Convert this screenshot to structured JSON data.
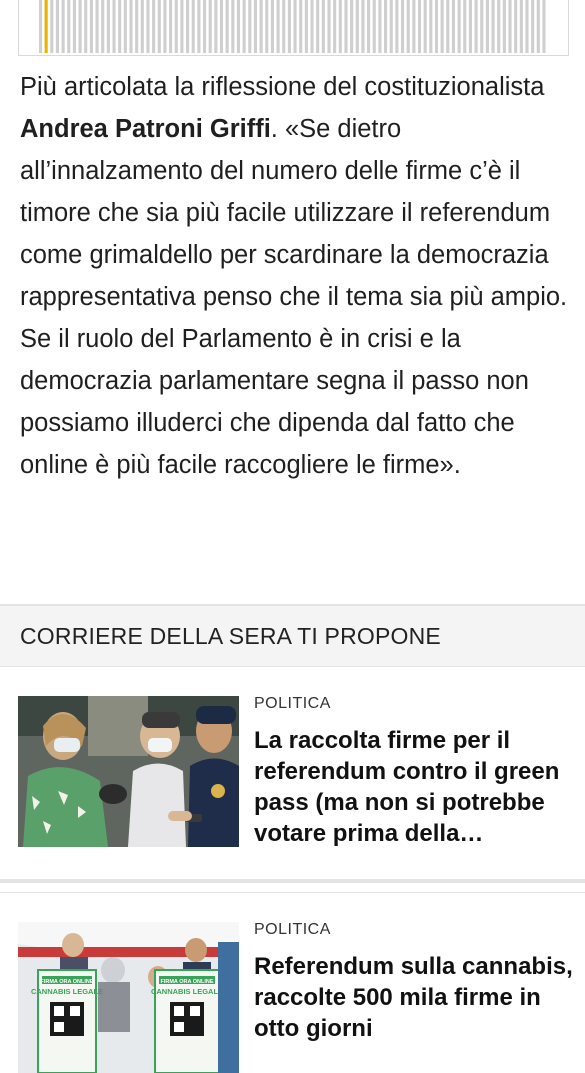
{
  "chart_strip": {
    "bar_count": 90,
    "highlight_index": 1,
    "highlight_color": "#e8b400",
    "bar_color": "#cfcfcf"
  },
  "article": {
    "paragraph_before": "Più articolata la riflessione del costituzionalista ",
    "author_name": "Andrea Patroni Griffi",
    "paragraph_after": ". «Se dietro all’innalzamento del numero delle firme c’è il timore che sia più facile utilizzare il referendum come grimaldello per scardinare la democrazia rappresentativa penso che il tema sia più ampio. Se il ruolo del Parlamento è in crisi e la democrazia parlamentare segna il passo non possiamo illuderci che dipenda dal fatto che online è più facile raccogliere le firme»."
  },
  "recommendations": {
    "header": "CORRIERE DELLA SERA TI PROPONE",
    "items": [
      {
        "category": "POLITICA",
        "headline": "La raccolta firme per il referendum contro il green pass (ma non si potrebbe votare prima della…",
        "image_icon": "photo-police-signature-thumbnail"
      },
      {
        "category": "POLITICA",
        "headline": "Referendum sulla cannabis, raccolte 500 mila firme in otto giorni",
        "image_icon": "photo-cannabis-legale-thumbnail",
        "sign_text_1": "FIRMA ORA ONLINE",
        "sign_text_2": "CANNABIS LEGALE"
      }
    ]
  }
}
